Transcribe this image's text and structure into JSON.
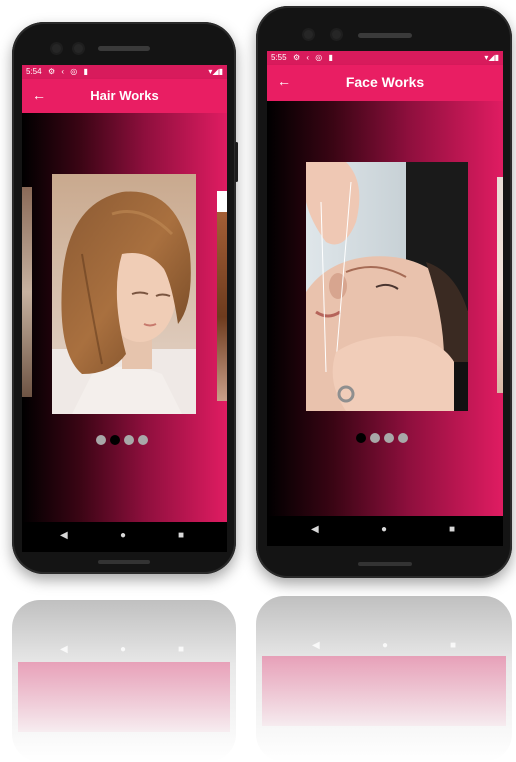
{
  "phone_left": {
    "status_time": "5:54",
    "title": "Hair Works",
    "dots": [
      false,
      true,
      false,
      false
    ]
  },
  "phone_right": {
    "status_time": "5:55",
    "title": "Face Works",
    "dots": [
      true,
      false,
      false,
      false
    ]
  },
  "colors": {
    "app_bar": "#e91e63",
    "status_bar": "#d81b5c",
    "gradient_start": "#000000",
    "gradient_end": "#e01c62"
  },
  "icons": {
    "back": "arrow-left-icon",
    "nav_back": "triangle-left-icon",
    "nav_home": "circle-icon",
    "nav_recents": "square-icon"
  }
}
